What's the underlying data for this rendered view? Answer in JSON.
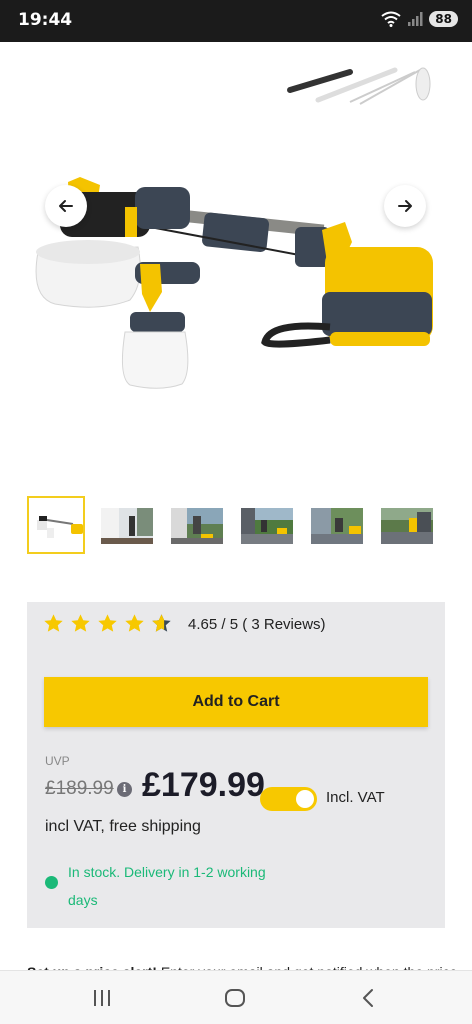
{
  "status": {
    "time": "19:44",
    "battery": "88"
  },
  "product": {
    "rating_text": "4.65 / 5 ( 3 Reviews)",
    "stars": 4.65,
    "add_to_cart": "Add to Cart",
    "uvp_label": "UVP",
    "old_price": "£189.99",
    "price": "£179.99",
    "vat_toggle_on": true,
    "vat_label": "Incl. VAT",
    "shipping": "incl VAT, free shipping",
    "stock_line1": "In stock. Delivery in 1-2 working",
    "stock_line2": "days",
    "stock_color": "#1bb978"
  },
  "alert": {
    "bold": "Set up a price alert!",
    "text": " Enter your email and get notified when the price"
  },
  "colors": {
    "accent": "#f7c800",
    "panel": "#e9e9eb"
  }
}
